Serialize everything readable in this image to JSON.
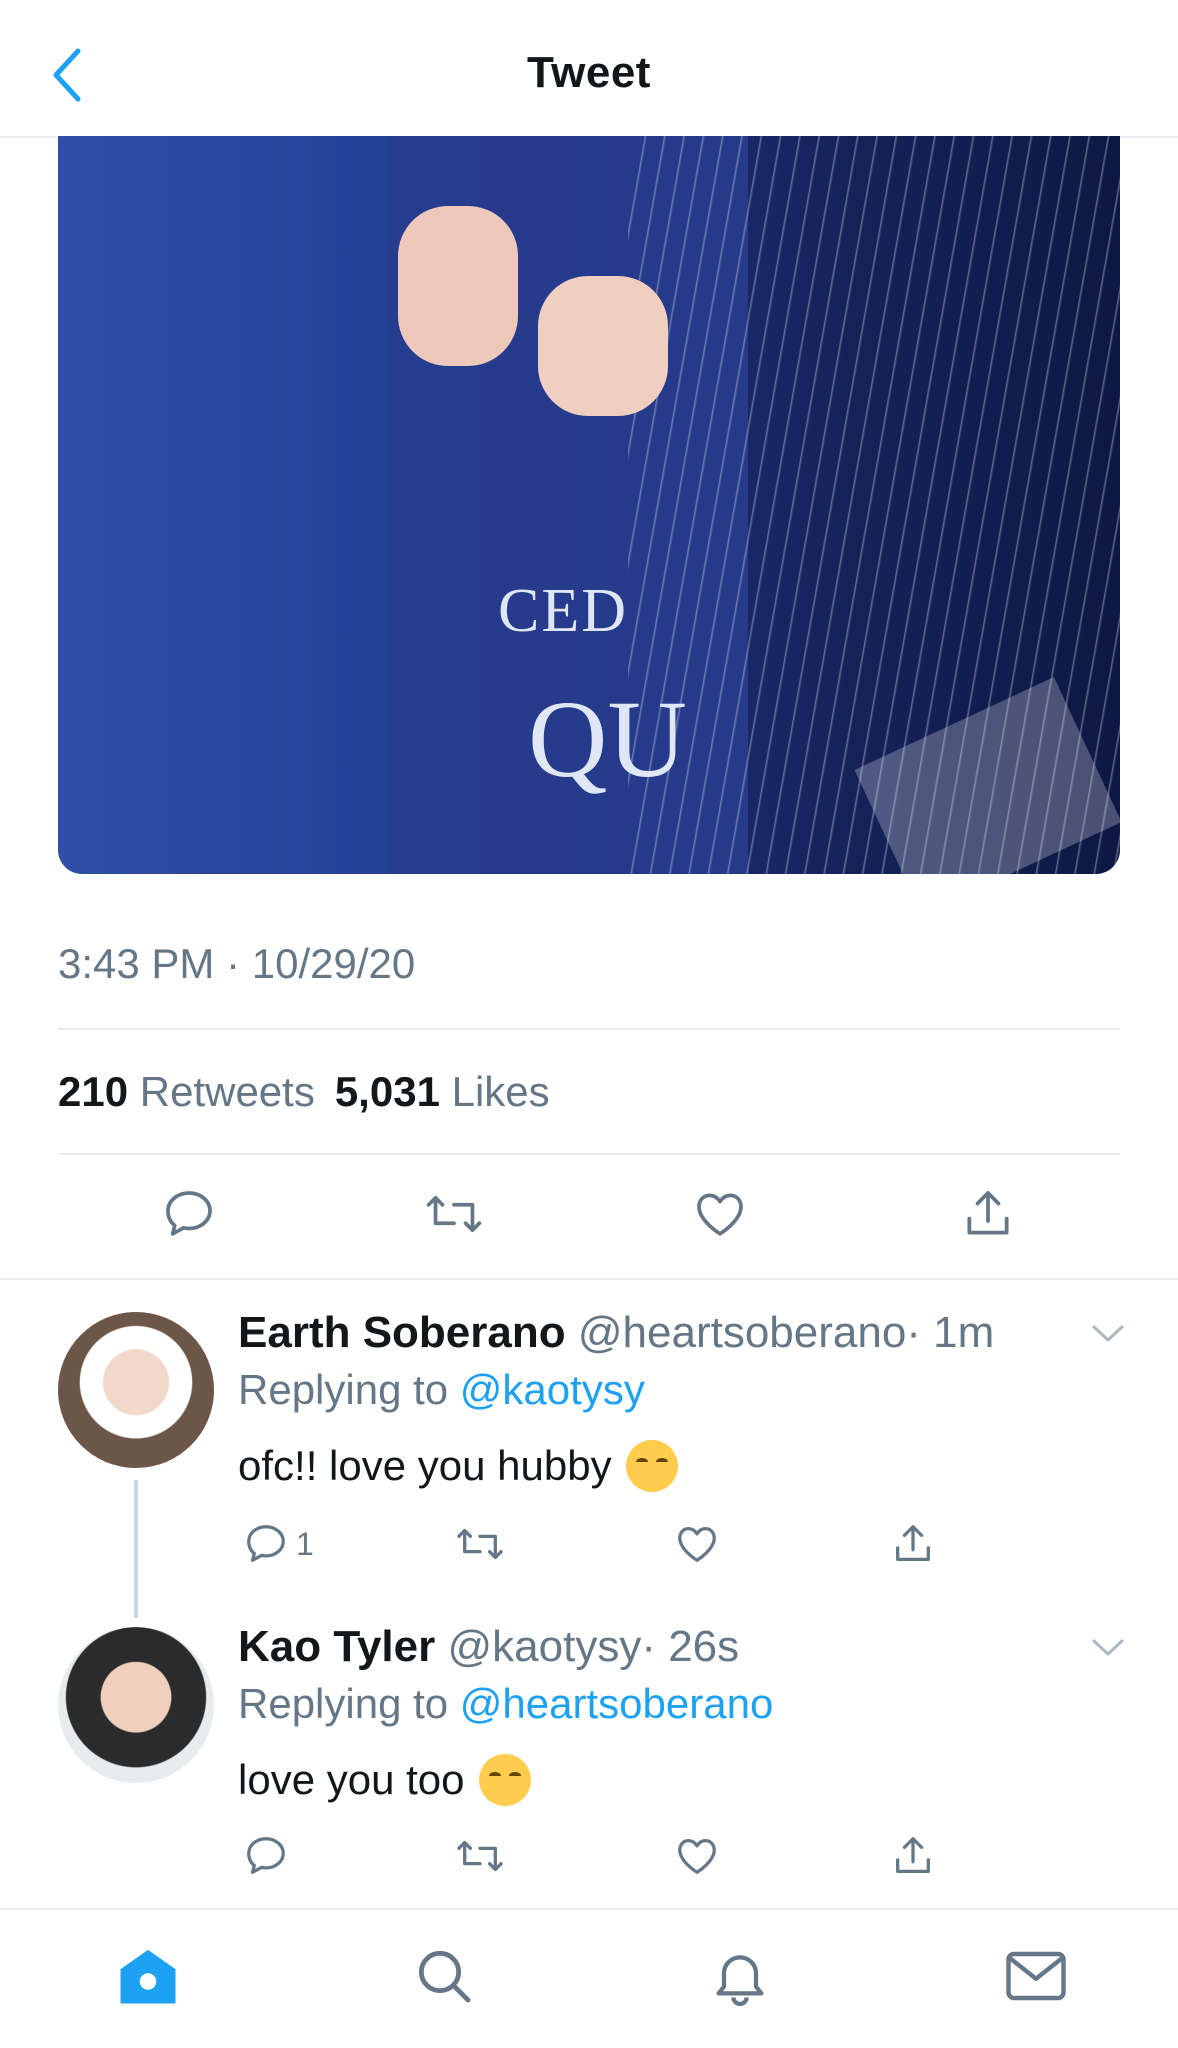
{
  "header": {
    "title": "Tweet"
  },
  "tweet": {
    "photo_text_1": "CED",
    "photo_text_2": "QU",
    "timestamp": "3:43 PM · 10/29/20",
    "retweets_count": "210",
    "retweets_label": "Retweets",
    "likes_count": "5,031",
    "likes_label": "Likes"
  },
  "replies": [
    {
      "name": "Earth Soberano",
      "handle": "@heartsoberano",
      "time": "· 1m",
      "replying_prefix": "Replying to",
      "replying_to": "@kaotysy",
      "text": "ofc!! love you hubby",
      "reply_count": "1"
    },
    {
      "name": "Kao Tyler",
      "handle": "@kaotysy",
      "time": "· 26s",
      "replying_prefix": "Replying to",
      "replying_to": "@heartsoberano",
      "text": "love you too",
      "reply_count": ""
    }
  ],
  "colors": {
    "accent": "#1da1f2",
    "secondary_text": "#657786",
    "divider": "#e6ecf0"
  }
}
